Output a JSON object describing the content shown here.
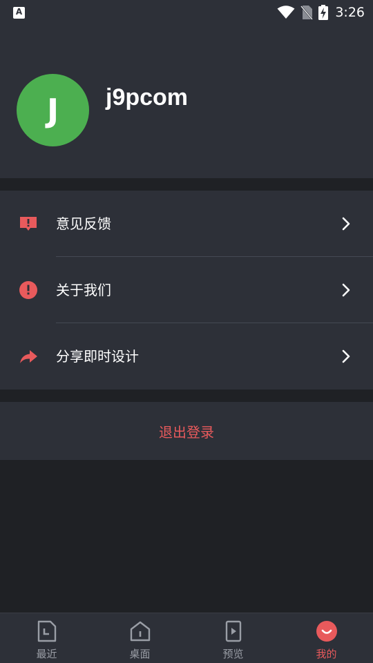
{
  "status_bar": {
    "left_icon": "A",
    "time": "3:26",
    "icons": [
      "wifi-icon",
      "no-sim-icon",
      "battery-charging-icon"
    ]
  },
  "profile": {
    "avatar_letter": "J",
    "avatar_color": "#4caf50",
    "username": "j9pcom"
  },
  "menu": {
    "items": [
      {
        "label": "意见反馈",
        "icon": "feedback-icon"
      },
      {
        "label": "关于我们",
        "icon": "info-alert-icon"
      },
      {
        "label": "分享即时设计",
        "icon": "share-icon"
      }
    ]
  },
  "logout": {
    "label": "退出登录"
  },
  "bottom_nav": {
    "items": [
      {
        "label": "最近",
        "icon": "recent-doc-icon",
        "active": false
      },
      {
        "label": "桌面",
        "icon": "home-icon",
        "active": false
      },
      {
        "label": "预览",
        "icon": "preview-icon",
        "active": false
      },
      {
        "label": "我的",
        "icon": "profile-smile-icon",
        "active": true
      }
    ]
  },
  "colors": {
    "accent": "#e85a5c",
    "surface": "#2d3038",
    "background": "#1f2125"
  }
}
